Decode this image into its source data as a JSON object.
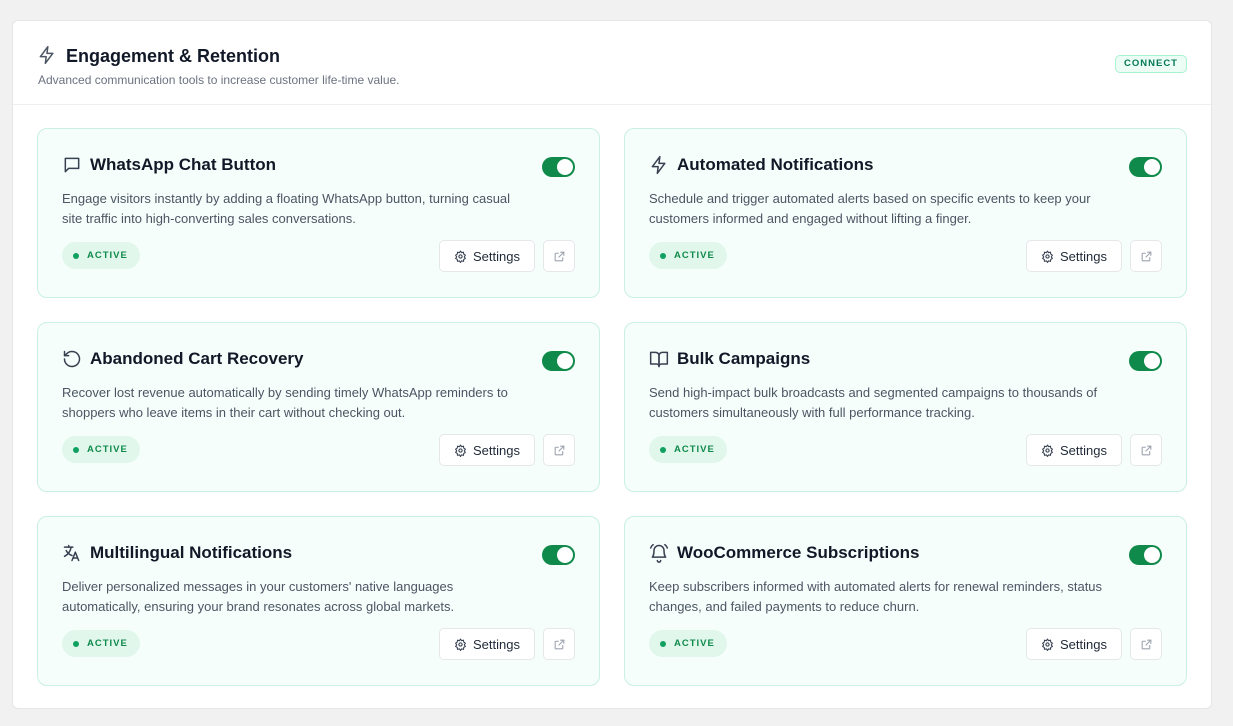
{
  "section": {
    "title": "Engagement & Retention",
    "icon": "lightning-icon",
    "description": "Advanced communication tools to increase customer life-time value.",
    "badge": "CONNECT"
  },
  "colors": {
    "accent": "#0f8a4a",
    "card_bg": "#f6fefb",
    "card_border": "#c9f0e0",
    "badge_bg": "#e1f7ec"
  },
  "features": [
    {
      "title": "WhatsApp Chat Button",
      "icon": "chat-bubble-icon",
      "description": "Engage visitors instantly by adding a floating WhatsApp button, turning casual site traffic into high-converting sales conversations.",
      "status": "ACTIVE",
      "enabled": true,
      "settings_label": "Settings"
    },
    {
      "title": "Automated Notifications",
      "icon": "lightning-icon",
      "description": "Schedule and trigger automated alerts based on specific events to keep your customers informed and engaged without lifting a finger.",
      "status": "ACTIVE",
      "enabled": true,
      "settings_label": "Settings"
    },
    {
      "title": "Abandoned Cart Recovery",
      "icon": "rotate-ccw-icon",
      "description": "Recover lost revenue automatically by sending timely WhatsApp reminders to shoppers who leave items in their cart without checking out.",
      "status": "ACTIVE",
      "enabled": true,
      "settings_label": "Settings"
    },
    {
      "title": "Bulk Campaigns",
      "icon": "open-book-icon",
      "description": "Send high-impact bulk broadcasts and segmented campaigns to thousands of customers simultaneously with full performance tracking.",
      "status": "ACTIVE",
      "enabled": true,
      "settings_label": "Settings"
    },
    {
      "title": "Multilingual Notifications",
      "icon": "translate-icon",
      "description": "Deliver personalized messages in your customers' native languages automatically, ensuring your brand resonates across global markets.",
      "status": "ACTIVE",
      "enabled": true,
      "settings_label": "Settings"
    },
    {
      "title": "WooCommerce Subscriptions",
      "icon": "bell-ring-icon",
      "description": "Keep subscribers informed with automated alerts for renewal reminders, status changes, and failed payments to reduce churn.",
      "status": "ACTIVE",
      "enabled": true,
      "settings_label": "Settings"
    }
  ]
}
